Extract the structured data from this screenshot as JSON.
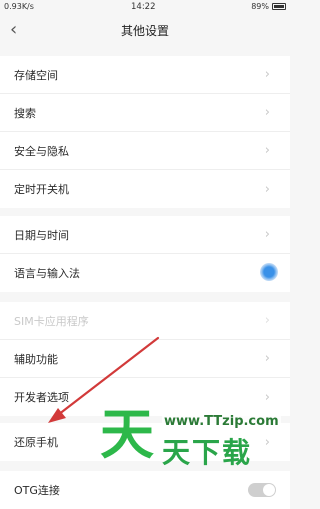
{
  "status": {
    "speed": "0.93K/s",
    "time": "14:22",
    "battery": "89%"
  },
  "header": {
    "title": "其他设置"
  },
  "groups": [
    {
      "items": [
        {
          "label": "存储空间"
        },
        {
          "label": "搜索"
        },
        {
          "label": "安全与隐私"
        },
        {
          "label": "定时开关机"
        }
      ]
    },
    {
      "items": [
        {
          "label": "日期与时间"
        },
        {
          "label": "语言与输入法"
        }
      ]
    },
    {
      "items": [
        {
          "label": "SIM卡应用程序"
        },
        {
          "label": "辅助功能"
        },
        {
          "label": "开发者选项"
        }
      ]
    },
    {
      "items": [
        {
          "label": "还原手机"
        }
      ]
    },
    {
      "items": [
        {
          "label": "OTG连接"
        }
      ]
    }
  ],
  "watermark": {
    "big": "天",
    "url": "www.TTzip.com",
    "small": "天下载"
  },
  "colors": {
    "annotation_arrow": "#d23a3a",
    "watermark_green": "#2db84a"
  }
}
